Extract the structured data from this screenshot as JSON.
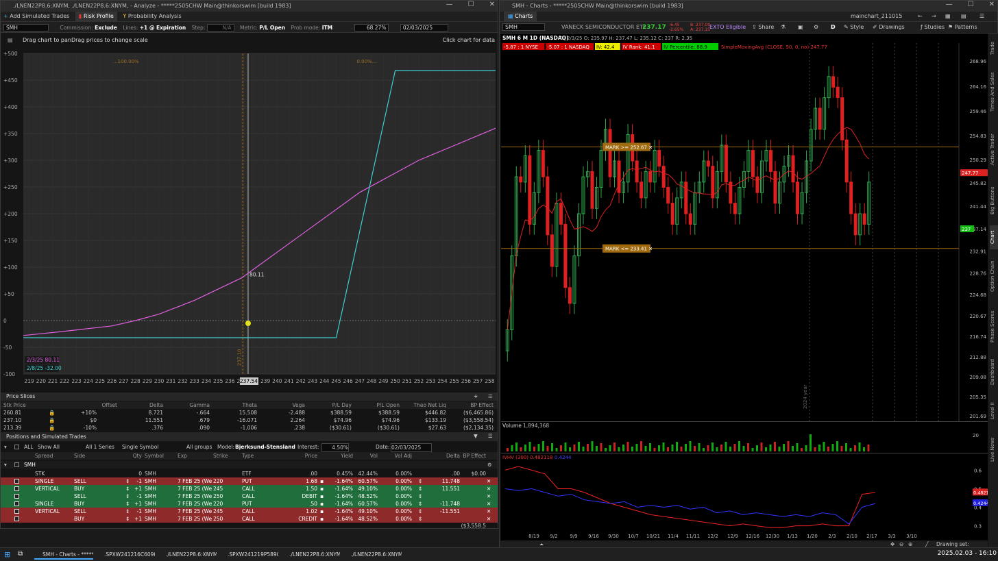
{
  "left_window": {
    "title": "./LNEN22P8.6:XNYM, ./LNEN22P8.6:XNYM, - Analyze - *****2505CHW Main@thinkorswim [build 1983]",
    "tabs": [
      "Add Simulated Trades",
      "Risk Profile",
      "Probability Analysis"
    ],
    "toolbar": {
      "symbol": "SMH",
      "commission_label": "Commission:",
      "commission_value": "Exclude",
      "lines_label": "Lines:",
      "lines_value": "+1 @ Expiration",
      "step_label": "Step:",
      "step_value": "N/A",
      "metric_label": "Metric:",
      "metric_value": "P/L Open",
      "prob_label": "Prob mode:",
      "prob_value": "ITM",
      "pct": "68.27%",
      "date": "02/03/2025"
    },
    "chart_hint_left": "Drag chart to panDrag prices to change scale",
    "chart_hint_right": "Click chart for data",
    "chart_data": {
      "type": "line",
      "x_ticks": [
        "219",
        "220",
        "221",
        "222",
        "223",
        "224",
        "225",
        "226",
        "227",
        "228",
        "229",
        "230",
        "231",
        "232",
        "233",
        "234",
        "235",
        "236",
        "237",
        "238",
        "239",
        "240",
        "241",
        "242",
        "243",
        "244",
        "245",
        "246",
        "247",
        "248",
        "249",
        "250",
        "251",
        "252",
        "253",
        "254",
        "255",
        "256",
        "257",
        "258"
      ],
      "y_ticks": [
        "+500",
        "+450",
        "+400",
        "+350",
        "+300",
        "+250",
        "+200",
        "+150",
        "+100",
        "+50",
        "0",
        "-50",
        "-100"
      ],
      "ylim": [
        -100,
        500
      ],
      "xlim": [
        218.5,
        258.5
      ],
      "series": [
        {
          "name": "2/3/25",
          "color": "#e060e0",
          "x": [
            218.5,
            222,
            226,
            228,
            230,
            233,
            237,
            242,
            247,
            252,
            258.5
          ],
          "y": [
            -28,
            -20,
            -10,
            0,
            12,
            38,
            80,
            160,
            240,
            300,
            360
          ]
        },
        {
          "name": "2/8/25",
          "color": "#3fd0d0",
          "x": [
            218.5,
            245,
            250,
            258.5
          ],
          "y": [
            -32,
            -32,
            468,
            468
          ]
        }
      ],
      "current_price": "237.54",
      "annotation_value": "80.11",
      "prob_labels": [
        "...100.00%",
        "0.00%..."
      ],
      "price_vertical_label": "237.10",
      "legend": [
        {
          "label": "2/3/25 80.11",
          "color": "#e060e0"
        },
        {
          "label": "2/8/25 -32.00",
          "color": "#3fd0d0"
        }
      ]
    },
    "price_slices": {
      "title": "Price Slices",
      "headers": [
        "Stk Price",
        "Offset",
        "Delta",
        "Gamma",
        "Theta",
        "Vega",
        "P/L Day",
        "P/L Open",
        "Theo Net Liq",
        "BP Effect"
      ],
      "rows": [
        [
          "260.81",
          "+10%",
          "8.721",
          "-.664",
          "15.508",
          "-2.488",
          "$388.59",
          "$388.59",
          "$446.82",
          "($6,465.86)"
        ],
        [
          "237.10",
          "$0",
          "11.551",
          ".679",
          "-16.071",
          "2.264",
          "$74.96",
          "$74.96",
          "$133.19",
          "($3,558.54)"
        ],
        [
          "213.39",
          "-10%",
          ".376",
          ".090",
          "-1.006",
          ".238",
          "($30.61)",
          "($30.61)",
          "$27.63",
          "($2,134.35)"
        ]
      ]
    },
    "positions": {
      "title": "Positions and Simulated Trades",
      "filters": [
        "ALL",
        "Show All",
        "All 1 Series",
        "Single Symbol",
        "All groups"
      ],
      "model_label": "Model:",
      "model_value": "Bjerksund-Stensland",
      "interest_label": "Interest:",
      "interest_value": "4.50%",
      "date_label": "Date:",
      "date_value": "02/03/2025",
      "headers": [
        "Spread",
        "Side",
        "Qty",
        "Symbol",
        "Exp",
        "Strike",
        "Type",
        "Price",
        "Yield",
        "Vol",
        "Vol Adj",
        "Delta",
        "BP Effect"
      ],
      "group": "SMH",
      "rows": [
        {
          "style": "plain",
          "spread": "STK",
          "side": "",
          "qty": "0",
          "symbol": "SMH",
          "exp": "",
          "strike": "",
          "type": "ETF",
          "price": ".00",
          "yield": "0.45%",
          "vol": "42.44%",
          "voladj": "0.00%",
          "delta": ".00",
          "bp": "$0.00"
        },
        {
          "style": "red",
          "spread": "SINGLE",
          "side": "SELL",
          "qty": "-1",
          "symbol": "SMH",
          "exp": "7 FEB 25 (Wee",
          "strike": "220",
          "type": "PUT",
          "price": "1.68",
          "yield": "-1.64%",
          "vol": "60.57%",
          "voladj": "0.00%",
          "delta": "11.748",
          "bp": ""
        },
        {
          "style": "grn",
          "spread": "VERTICAL",
          "side": "BUY",
          "qty": "+1",
          "symbol": "SMH",
          "exp": "7 FEB 25 (Wee",
          "strike": "245",
          "type": "CALL",
          "price": "1.50",
          "yield": "-1.64%",
          "vol": "49.10%",
          "voladj": "0.00%",
          "delta": "11.551",
          "bp": ""
        },
        {
          "style": "grn",
          "spread": "",
          "side": "SELL",
          "qty": "-1",
          "symbol": "SMH",
          "exp": "7 FEB 25 (Wee",
          "strike": "250",
          "type": "CALL",
          "price": "DEBIT",
          "yield": "-1.64%",
          "vol": "48.52%",
          "voladj": "0.00%",
          "delta": "",
          "bp": ""
        },
        {
          "style": "grn",
          "spread": "SINGLE",
          "side": "BUY",
          "qty": "+1",
          "symbol": "SMH",
          "exp": "7 FEB 25 (Wee",
          "strike": "220",
          "type": "PUT",
          "price": ".50",
          "yield": "-1.64%",
          "vol": "60.57%",
          "voladj": "0.00%",
          "delta": "-11.748",
          "bp": ""
        },
        {
          "style": "red",
          "spread": "VERTICAL",
          "side": "SELL",
          "qty": "-1",
          "symbol": "SMH",
          "exp": "7 FEB 25 (Wee",
          "strike": "245",
          "type": "CALL",
          "price": "1.02",
          "yield": "-1.64%",
          "vol": "49.10%",
          "voladj": "0.00%",
          "delta": "-11.551",
          "bp": ""
        },
        {
          "style": "red",
          "spread": "",
          "side": "BUY",
          "qty": "+1",
          "symbol": "SMH",
          "exp": "7 FEB 25 (Wee",
          "strike": "250",
          "type": "CALL",
          "price": "CREDIT",
          "yield": "-1.64%",
          "vol": "48.52%",
          "voladj": "0.00%",
          "delta": "",
          "bp": ""
        }
      ],
      "total": "($3,558.5"
    }
  },
  "right_window": {
    "title": "SMH - Charts - *****2505CHW Main@thinkorswim [build 1983]",
    "tab": "Charts",
    "toolbar": {
      "symbol": "SMH",
      "name": "VANECK SEMICONDUCTOR ETF",
      "last": "237.17",
      "chg": "-6.45",
      "chg_pct": "-2.65%",
      "bid": "B: 237.00",
      "ask": "A: 237.15",
      "ext": "EXTO Eligible",
      "share": "Share",
      "right_label": "mainchart_211015",
      "period": "D",
      "style": "Style",
      "drawings": "Drawings",
      "studies": "Studies",
      "patterns": "Patterns"
    },
    "header": {
      "desc": "SMH 6 M 1D (NASDAQ)",
      "ohlc": "D: 2/3/25  O: 235.97  H: 237.47  L: 235.12  C: 237  R: 2.35",
      "b1": "-5.87 : 1 NYSE",
      "b2": "-5.07 : 1 NASDAQ",
      "iv": "IV: 42.4",
      "ivrank": "IV Rank: 41.1",
      "ivpct": "IV Percentile: 88.9",
      "sma": "SimpleMovingAvg (CLOSE, 50, 0, no)",
      "sma_val": "247.77"
    },
    "price_axis": [
      "268.96",
      "264.16",
      "259.46",
      "254.83",
      "250.29",
      "245.82",
      "241.44",
      "237.14",
      "232.91",
      "228.76",
      "224.68",
      "220.67",
      "216.74",
      "212.88",
      "209.08",
      "205.35",
      "201.69"
    ],
    "date_axis": [
      "8/19",
      "9/2",
      "9/9",
      "9/16",
      "9/30",
      "10/7",
      "10/21",
      "11/4",
      "11/11",
      "12/2",
      "12/9",
      "12/16",
      "12/30",
      "1/13",
      "1/20",
      "2/3",
      "2/10",
      "2/17",
      "3/3",
      "3/10"
    ],
    "marks": [
      "MARK >= 252.67",
      "MARK <= 233.41"
    ],
    "price_tags": {
      "sma": "247.77",
      "last": "237"
    },
    "volume_label": "Volume",
    "volume_value": "1,894,368",
    "ivhv_label": "IVHV (300)",
    "ivhv_v1": "0.482118",
    "ivhv_v2": "0.4244",
    "ivhv_axis": [
      "0.6",
      "0.5",
      "0.4",
      "0.3"
    ],
    "ivhv_tags": [
      "0.48212",
      "0.4244"
    ],
    "vol_axis": "20",
    "footer": "Drawing set: Default",
    "year_label": "2024 year",
    "sidebar": [
      "Trade",
      "Times And Sales",
      "Active Trader",
      "Big Buttons",
      "Chart",
      "Option Chain",
      "Phase Scores",
      "Dashboard",
      "Level II",
      "Live News"
    ]
  },
  "taskbar": {
    "items": [
      "SMH - Charts - *****2...",
      ".SPXW241216C6090, ...",
      "./LNEN22P8.6:XNYM...",
      ".SPXW241219P5890, ...",
      "./LNEN22P8.6:XNYM...",
      "./LNEN22P8.6:XNYM..."
    ],
    "clock": "2025.02.03 - 16:10"
  },
  "colors": {
    "red_row": "#8e2a2a",
    "green_row": "#1f6e3c",
    "candle_up": "#2fa84f",
    "candle_down": "#e02020",
    "accent_blue": "#0a84ff"
  }
}
